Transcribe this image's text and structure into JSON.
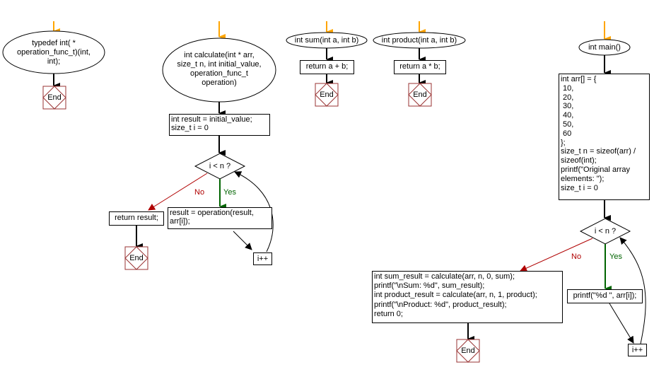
{
  "colors": {
    "start_arrow": "#ffa500",
    "flow_line": "#000000",
    "no_branch": "#b00000",
    "yes_branch": "#006400",
    "end_border": "#993333"
  },
  "flowcharts": {
    "typedef": {
      "start": "typedef int( *\noperation_func_t)(int,\nint);",
      "end": "End"
    },
    "calculate": {
      "start": "int calculate(int * arr,\nsize_t n, int initial_value,\noperation_func_t\noperation)",
      "init": "int result = initial_value;\nsize_t i = 0",
      "condition": "i < n ?",
      "no_label": "No",
      "yes_label": "Yes",
      "body": "result = operation(result,\narr[i]);",
      "increment": "i++",
      "return": "return result;",
      "end": "End"
    },
    "sum": {
      "start": "int sum(int a, int b)",
      "body": "return a + b;",
      "end": "End"
    },
    "product": {
      "start": "int product(int a, int b)",
      "body": "return a * b;",
      "end": "End"
    },
    "main": {
      "start": "int main()",
      "init": "int arr[] = {\n 10,\n 20,\n 30,\n 40,\n 50,\n 60\n};\nsize_t n = sizeof(arr) /\nsizeof(int);\nprintf(\"Original array\nelements: \");\nsize_t i = 0",
      "condition": "i < n ?",
      "no_label": "No",
      "yes_label": "Yes",
      "body": "printf(\"%d \", arr[i]);",
      "increment": "i++",
      "after_loop": "int sum_result = calculate(arr, n, 0, sum);\nprintf(\"\\nSum: %d\", sum_result);\nint product_result = calculate(arr, n, 1, product);\nprintf(\"\\nProduct: %d\", product_result);\nreturn 0;",
      "end": "End"
    }
  }
}
